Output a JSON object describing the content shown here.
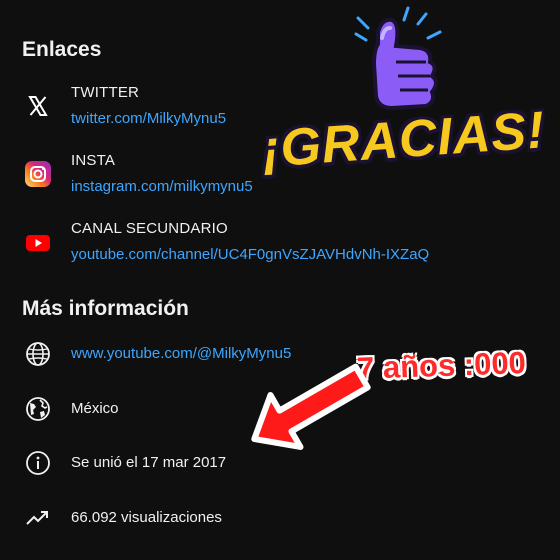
{
  "links_section": {
    "title": "Enlaces",
    "items": [
      {
        "title": "TWITTER",
        "url": "twitter.com/MilkyMynu5",
        "icon": "x-twitter-icon"
      },
      {
        "title": "INSTA",
        "url": "instagram.com/milkymynu5",
        "icon": "instagram-icon"
      },
      {
        "title": "CANAL SECUNDARIO",
        "url": "youtube.com/channel/UC4F0gnVsZJAVHdvNh-IXZaQ",
        "icon": "youtube-icon"
      }
    ]
  },
  "more_info": {
    "title": "Más información",
    "channel_url": "www.youtube.com/@MilkyMynu5",
    "country": "México",
    "joined": "Se unió el 17 mar 2017",
    "views": "66.092 visualizaciones"
  },
  "overlay": {
    "gracias": "¡GRACIAS!",
    "annotation": "7 años :000"
  },
  "colors": {
    "background": "#0f0f0f",
    "link": "#3ea6ff",
    "text": "#f1f1f1",
    "youtube_red": "#ff0000",
    "thumb_purple": "#8b5cf6",
    "gracias_yellow": "#f7c81e",
    "annotation_red": "#ff2a2a"
  }
}
